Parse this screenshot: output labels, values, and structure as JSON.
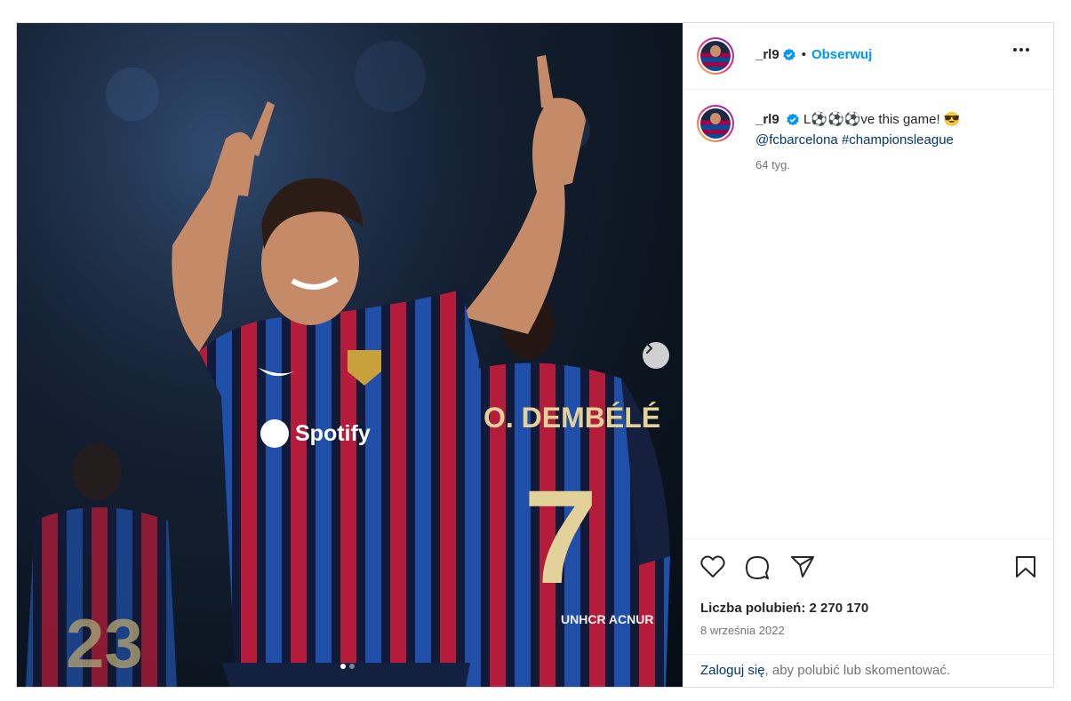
{
  "post": {
    "username": "_rl9",
    "follow_label": "Obserwuj",
    "separator": "•",
    "caption": {
      "prefix": "L⚽⚽⚽ve this game! 😎",
      "mention": "@fcbarcelona",
      "hashtag": "#championsleague"
    },
    "time_ago": "64 tyg.",
    "likes_label": "Liczba polubień: 2 270 170",
    "date": "8 września 2022",
    "login": {
      "link": "Zaloguj się",
      "rest": ", aby polubić lub skomentować."
    }
  },
  "photo": {
    "sponsor": "Spotify",
    "player_name": "O. DEMBÉLÉ",
    "player_number": "7",
    "partner": "UNHCR ACNUR",
    "back_number": "23",
    "slides_total": 2,
    "slide_active": 1
  },
  "colors": {
    "accent": "#0095f6",
    "link": "#00376b",
    "verified": "#0095f6",
    "barca_blue": "#1f4fa8",
    "barca_red": "#b51c3a"
  }
}
